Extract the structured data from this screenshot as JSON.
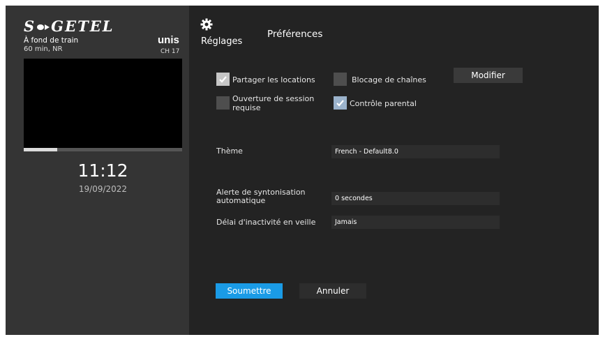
{
  "brand": {
    "logo_text_left": "S",
    "logo_text_right": "GETEL",
    "provider": "unis"
  },
  "now_playing": {
    "title": "À fond de train",
    "meta": "60 min, NR",
    "channel": "CH 17",
    "progress_fraction": 0.21
  },
  "clock": {
    "time": "11:12",
    "date": "19/09/2022"
  },
  "header": {
    "settings_label": "Réglages",
    "page_title": "Préférences"
  },
  "options": {
    "share_rentals": {
      "label": "Partager les locations",
      "checked": true
    },
    "channel_blocking": {
      "label": "Blocage de chaînes",
      "checked": false
    },
    "modify_label": "Modifier",
    "login_required": {
      "label_line1": "Ouverture de session",
      "label_line2": "requise",
      "checked": false
    },
    "parental_control": {
      "label": "Contrôle parental",
      "checked": true
    }
  },
  "fields": {
    "theme": {
      "label": "Thème",
      "value": "French - Default8.0"
    },
    "auto_tune": {
      "label_line1": "Alerte de syntonisation",
      "label_line2": "automatique",
      "value": "0 secondes"
    },
    "standby": {
      "label": "Délai d'inactivité en veille",
      "value": "Jamais"
    }
  },
  "actions": {
    "submit_label": "Soumettre",
    "cancel_label": "Annuler"
  },
  "colors": {
    "accent": "#1a9be6",
    "screen_bg": "#232323",
    "panel_bg": "#343434"
  }
}
